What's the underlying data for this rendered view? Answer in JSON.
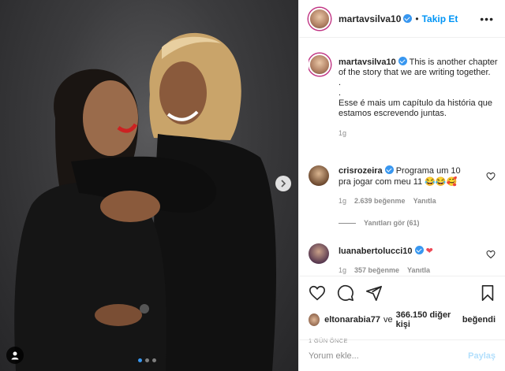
{
  "post": {
    "carousel": {
      "slide_count": 3,
      "active_index": 0
    }
  },
  "header": {
    "username": "martavsilva10",
    "separator": "•",
    "follow_label": "Takip Et",
    "more_label": "•••"
  },
  "caption": {
    "username": "martavsilva10",
    "lines": [
      "This is another chapter of the story that we are writing together.",
      ".",
      ".",
      "Esse é mais um capítulo da história que estamos escrevendo juntas."
    ],
    "time": "1g"
  },
  "comments": [
    {
      "username": "crisrozeira",
      "text": "Programa um 10 pra jogar com meu 11 😂😂🥰",
      "time": "1g",
      "likes": "2.639 beğenme",
      "reply": "Yanıtla",
      "view_replies": "Yanıtları gör (61)"
    },
    {
      "username": "luanabertolucci10",
      "text": "❤",
      "time": "1g",
      "likes": "357 beğenme",
      "reply": "Yanıtla"
    }
  ],
  "likes_row": {
    "liker": "eltonarabia77",
    "connector": "ve",
    "others": "366.150 diğer kişi",
    "suffix": "beğendi"
  },
  "time_ago": "1 GÜN ÖNCE",
  "add_comment": {
    "placeholder": "Yorum ekle...",
    "post_label": "Paylaş"
  },
  "colors": {
    "accent": "#0095f6",
    "verified": "#3897f0",
    "heart": "#ed4956",
    "muted": "#8e8e8e"
  },
  "icons": [
    "heart-icon",
    "comment-icon",
    "share-icon",
    "bookmark-icon",
    "chevron-right-icon",
    "user-tag-icon",
    "more-icon",
    "verified-icon"
  ]
}
